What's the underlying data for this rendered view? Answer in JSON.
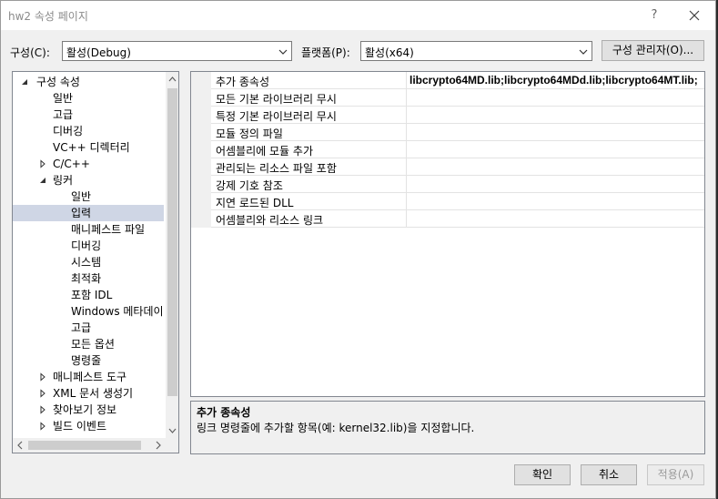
{
  "window": {
    "title": "hw2 속성 페이지",
    "help_label": "?"
  },
  "config": {
    "label": "구성(C):",
    "value": "활성(Debug)"
  },
  "platform": {
    "label": "플랫폼(P):",
    "value": "활성(x64)"
  },
  "config_manager_label": "구성 관리자(O)...",
  "tree": [
    {
      "label": "구성 속성",
      "level": 0,
      "expander": "expanded"
    },
    {
      "label": "일반",
      "level": 1,
      "expander": "none"
    },
    {
      "label": "고급",
      "level": 1,
      "expander": "none"
    },
    {
      "label": "디버깅",
      "level": 1,
      "expander": "none"
    },
    {
      "label": "VC++ 디렉터리",
      "level": 1,
      "expander": "none"
    },
    {
      "label": "C/C++",
      "level": 1,
      "expander": "collapsed"
    },
    {
      "label": "링커",
      "level": 1,
      "expander": "expanded"
    },
    {
      "label": "일반",
      "level": 2,
      "expander": "none"
    },
    {
      "label": "입력",
      "level": 2,
      "expander": "none",
      "selected": true
    },
    {
      "label": "매니페스트 파일",
      "level": 2,
      "expander": "none"
    },
    {
      "label": "디버깅",
      "level": 2,
      "expander": "none"
    },
    {
      "label": "시스템",
      "level": 2,
      "expander": "none"
    },
    {
      "label": "최적화",
      "level": 2,
      "expander": "none"
    },
    {
      "label": "포함 IDL",
      "level": 2,
      "expander": "none"
    },
    {
      "label": "Windows 메타데이",
      "level": 2,
      "expander": "none"
    },
    {
      "label": "고급",
      "level": 2,
      "expander": "none"
    },
    {
      "label": "모든 옵션",
      "level": 2,
      "expander": "none"
    },
    {
      "label": "명령줄",
      "level": 2,
      "expander": "none"
    },
    {
      "label": "매니페스트 도구",
      "level": 1,
      "expander": "collapsed"
    },
    {
      "label": "XML 문서 생성기",
      "level": 1,
      "expander": "collapsed"
    },
    {
      "label": "찾아보기 정보",
      "level": 1,
      "expander": "collapsed"
    },
    {
      "label": "빌드 이벤트",
      "level": 1,
      "expander": "collapsed"
    }
  ],
  "properties": [
    {
      "name": "추가 종속성",
      "value": "libcrypto64MD.lib;libcrypto64MDd.lib;libcrypto64MT.lib;",
      "bold": true
    },
    {
      "name": "모든 기본 라이브러리 무시",
      "value": ""
    },
    {
      "name": "특정 기본 라이브러리 무시",
      "value": ""
    },
    {
      "name": "모듈 정의 파일",
      "value": ""
    },
    {
      "name": "어셈블리에 모듈 추가",
      "value": ""
    },
    {
      "name": "관리되는 리소스 파일 포함",
      "value": ""
    },
    {
      "name": "강제 기호 참조",
      "value": ""
    },
    {
      "name": "지연 로드된 DLL",
      "value": ""
    },
    {
      "name": "어셈블리와 리소스 링크",
      "value": ""
    }
  ],
  "description": {
    "title": "추가 종속성",
    "text": "링크 명령줄에 추가할 항목(예: kernel32.lib)을 지정합니다."
  },
  "buttons": {
    "ok": "확인",
    "cancel": "취소",
    "apply": "적용(A)"
  }
}
